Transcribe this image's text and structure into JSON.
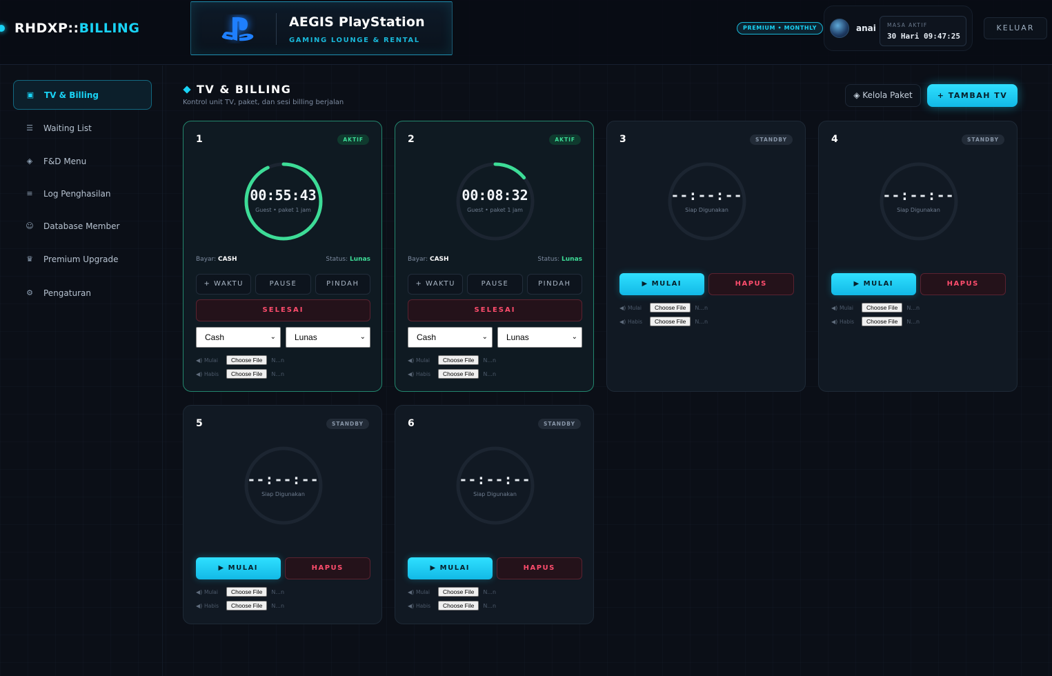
{
  "app": {
    "brand_prefix": "RHDXP::",
    "brand_accent": "BILLING",
    "lounge_title": "AEGIS PlayStation",
    "lounge_subtitle": "GAMING LOUNGE & RENTAL",
    "plan_badge": "PREMIUM • MONTHLY",
    "user_name": "anai",
    "active_label": "MASA AKTIF",
    "active_time": "30 Hari 09:47:25",
    "logout_label": "KELUAR"
  },
  "sidebar": {
    "items": [
      {
        "label": "TV & Billing",
        "icon": "monitor-icon",
        "glyph": "▣"
      },
      {
        "label": "Waiting List",
        "icon": "list-icon",
        "glyph": "☰"
      },
      {
        "label": "F&D Menu",
        "icon": "diamond-icon",
        "glyph": "◈"
      },
      {
        "label": "Log Penghasilan",
        "icon": "log-icon",
        "glyph": "≡"
      },
      {
        "label": "Database Member",
        "icon": "member-icon",
        "glyph": "☺"
      },
      {
        "label": "Premium Upgrade",
        "icon": "crown-icon",
        "glyph": "♛"
      },
      {
        "label": "Pengaturan",
        "icon": "gear-icon",
        "glyph": "⚙"
      }
    ]
  },
  "page": {
    "title": "TV & BILLING",
    "subtitle": "Kontrol unit TV, paket, dan sesi billing berjalan",
    "manage_label": "◈ Kelola Paket",
    "add_label": "+ TAMBAH TV"
  },
  "labels": {
    "pay_prefix": "Bayar:",
    "status_prefix": "Status:",
    "add_time": "+ WAKTU",
    "pause": "PAUSE",
    "move": "PINDAH",
    "finish": "SELESAI",
    "start": "▶ MULAI",
    "delete": "HAPUS",
    "sound_start": "Mulai",
    "sound_end": "Habis",
    "choose_file": "Choose File",
    "no_file": "N...n",
    "idle_time": "--:--:--",
    "idle_sub": "Siap Digunakan"
  },
  "units": [
    {
      "num": "1",
      "status": "AKTIF",
      "time": "00:55:43",
      "sub": "Guest • paket 1 jam",
      "progress": 0.93,
      "pay": "CASH",
      "pay_status": "Lunas",
      "method": "Cash",
      "paid": "Lunas"
    },
    {
      "num": "2",
      "status": "AKTIF",
      "time": "00:08:32",
      "sub": "Guest • paket 1 jam",
      "progress": 0.14,
      "pay": "CASH",
      "pay_status": "Lunas",
      "method": "Cash",
      "paid": "Lunas"
    },
    {
      "num": "3",
      "status": "STANDBY"
    },
    {
      "num": "4",
      "status": "STANDBY"
    },
    {
      "num": "5",
      "status": "STANDBY"
    },
    {
      "num": "6",
      "status": "STANDBY"
    }
  ],
  "colors": {
    "accent": "#19d3f5",
    "active": "#3ddc97",
    "danger": "#ff4d6d"
  }
}
